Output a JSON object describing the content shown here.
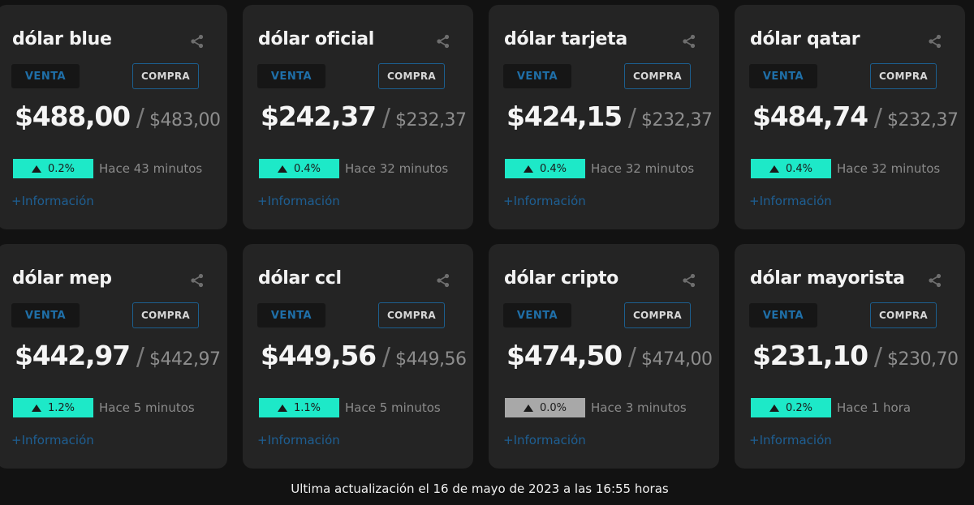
{
  "cards": [
    {
      "title": "dólar blue",
      "venta_label": "VENTA",
      "compra_label": "COMPRA",
      "venta": "$488,00",
      "separator": "/",
      "compra": "$483,00",
      "change": "0.2%",
      "change_trend": "up",
      "updated": "Hace 43 minutos",
      "more_info": "+Información"
    },
    {
      "title": "dólar oficial",
      "venta_label": "VENTA",
      "compra_label": "COMPRA",
      "venta": "$242,37",
      "separator": "/",
      "compra": "$232,37",
      "change": "0.4%",
      "change_trend": "up",
      "updated": "Hace 32 minutos",
      "more_info": "+Información"
    },
    {
      "title": "dólar tarjeta",
      "venta_label": "VENTA",
      "compra_label": "COMPRA",
      "venta": "$424,15",
      "separator": "/",
      "compra": "$232,37",
      "change": "0.4%",
      "change_trend": "up",
      "updated": "Hace 32 minutos",
      "more_info": "+Información"
    },
    {
      "title": "dólar qatar",
      "venta_label": "VENTA",
      "compra_label": "COMPRA",
      "venta": "$484,74",
      "separator": "/",
      "compra": "$232,37",
      "change": "0.4%",
      "change_trend": "up",
      "updated": "Hace 32 minutos",
      "more_info": "+Información"
    },
    {
      "title": "dólar mep",
      "venta_label": "VENTA",
      "compra_label": "COMPRA",
      "venta": "$442,97",
      "separator": "/",
      "compra": "$442,97",
      "change": "1.2%",
      "change_trend": "up",
      "updated": "Hace 5 minutos",
      "more_info": "+Información"
    },
    {
      "title": "dólar ccl",
      "venta_label": "VENTA",
      "compra_label": "COMPRA",
      "venta": "$449,56",
      "separator": "/",
      "compra": "$449,56",
      "change": "1.1%",
      "change_trend": "up",
      "updated": "Hace 5 minutos",
      "more_info": "+Información"
    },
    {
      "title": "dólar cripto",
      "venta_label": "VENTA",
      "compra_label": "COMPRA",
      "venta": "$474,50",
      "separator": "/",
      "compra": "$474,00",
      "change": "0.0%",
      "change_trend": "flat",
      "updated": "Hace 3 minutos",
      "more_info": "+Información"
    },
    {
      "title": "dólar mayorista",
      "venta_label": "VENTA",
      "compra_label": "COMPRA",
      "venta": "$231,10",
      "separator": "/",
      "compra": "$230,70",
      "change": "0.2%",
      "change_trend": "up",
      "updated": "Hace 1 hora",
      "more_info": "+Información"
    }
  ],
  "colors": {
    "background": "#121212",
    "card": "#242424",
    "accent_up": "#1de9c8",
    "accent_flat": "#a8a8a8",
    "link": "#1e5f93"
  },
  "footer": "Ultima actualización el 16 de mayo de 2023 a las 16:55 horas"
}
